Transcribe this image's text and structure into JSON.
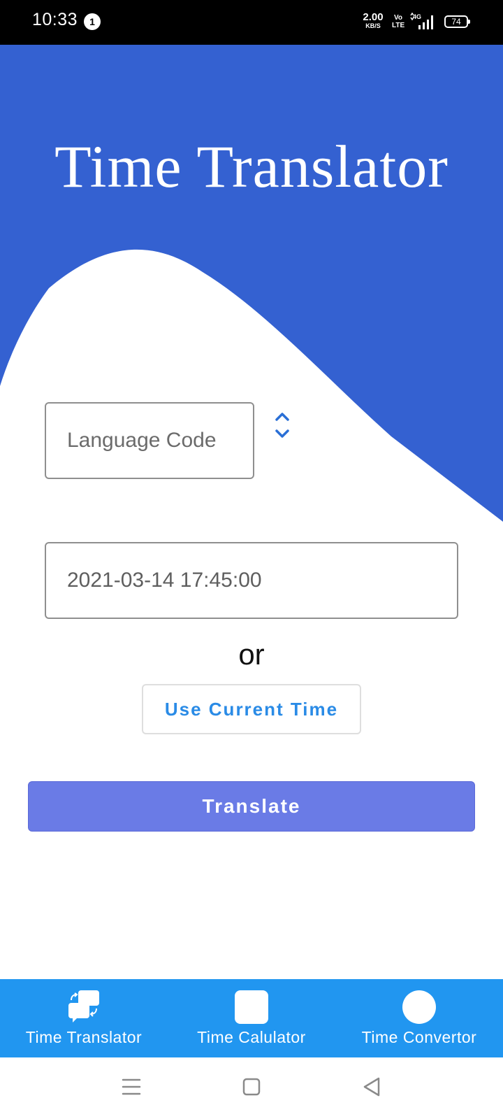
{
  "status_bar": {
    "time": "10:33",
    "notification_count": "1",
    "net_speed_value": "2.00",
    "net_speed_unit": "KB/S",
    "volte_line1": "Vo",
    "volte_line2": "LTE",
    "network_type": "4G",
    "battery": "74"
  },
  "header": {
    "title": "Time Translator",
    "accent_color": "#3461d1"
  },
  "form": {
    "language_placeholder": "Language Code",
    "language_value": "",
    "datetime_value": "2021-03-14 17:45:00",
    "or_text": "or",
    "use_current_time_label": "Use Current Time",
    "translate_label": "Translate"
  },
  "bottom_nav": {
    "items": [
      {
        "label": "Time Translator",
        "icon": "chat-bubbles-icon",
        "active": true
      },
      {
        "label": "Time Calulator",
        "icon": "square-icon",
        "active": false
      },
      {
        "label": "Time Convertor",
        "icon": "circle-icon",
        "active": false
      }
    ],
    "color": "#2196f0"
  },
  "system_nav": {
    "buttons": [
      "menu-icon",
      "home-icon",
      "back-icon"
    ]
  }
}
